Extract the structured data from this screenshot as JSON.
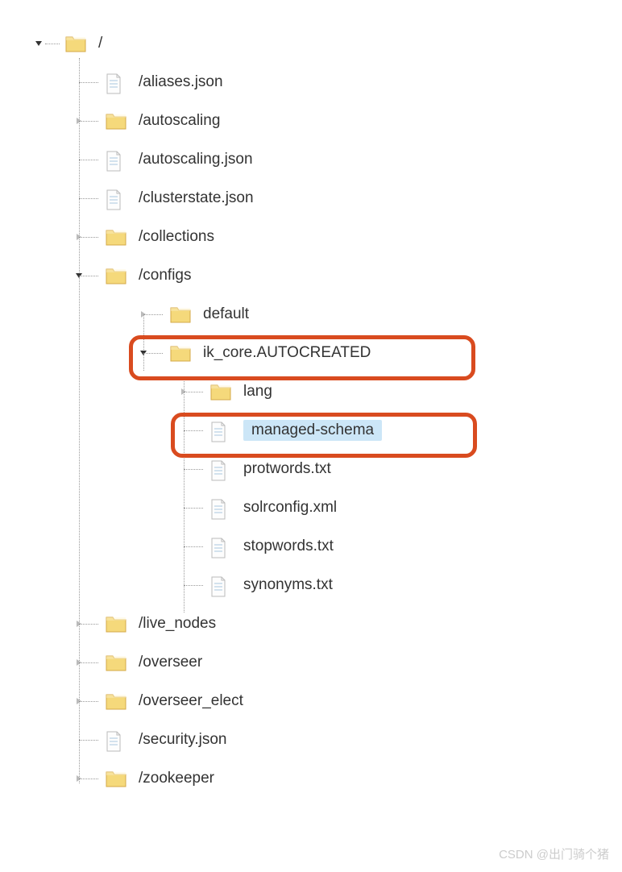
{
  "tree": {
    "root": {
      "label": "/",
      "type": "folder",
      "expanded": true
    },
    "items": [
      {
        "label": "/aliases.json",
        "type": "file",
        "indent": 1
      },
      {
        "label": "/autoscaling",
        "type": "folder",
        "indent": 1
      },
      {
        "label": "/autoscaling.json",
        "type": "file",
        "indent": 1
      },
      {
        "label": "/clusterstate.json",
        "type": "file",
        "indent": 1
      },
      {
        "label": "/collections",
        "type": "folder",
        "indent": 1
      },
      {
        "label": "/configs",
        "type": "folder",
        "indent": 1,
        "expanded": true
      },
      {
        "label": "default",
        "type": "folder",
        "indent": 2
      },
      {
        "label": "ik_core.AUTOCREATED",
        "type": "folder",
        "indent": 2,
        "expanded": true,
        "highlighted": true
      },
      {
        "label": "lang",
        "type": "folder",
        "indent": 3
      },
      {
        "label": "managed-schema",
        "type": "file",
        "indent": 3,
        "selected": true,
        "highlighted": true
      },
      {
        "label": "protwords.txt",
        "type": "file",
        "indent": 3
      },
      {
        "label": "solrconfig.xml",
        "type": "file",
        "indent": 3
      },
      {
        "label": "stopwords.txt",
        "type": "file",
        "indent": 3
      },
      {
        "label": "synonyms.txt",
        "type": "file",
        "indent": 3
      },
      {
        "label": "/live_nodes",
        "type": "folder",
        "indent": 1
      },
      {
        "label": "/overseer",
        "type": "folder",
        "indent": 1
      },
      {
        "label": "/overseer_elect",
        "type": "folder",
        "indent": 1
      },
      {
        "label": "/security.json",
        "type": "file",
        "indent": 1
      },
      {
        "label": "/zookeeper",
        "type": "folder",
        "indent": 1
      }
    ]
  },
  "watermark": "CSDN @出门骑个猪"
}
